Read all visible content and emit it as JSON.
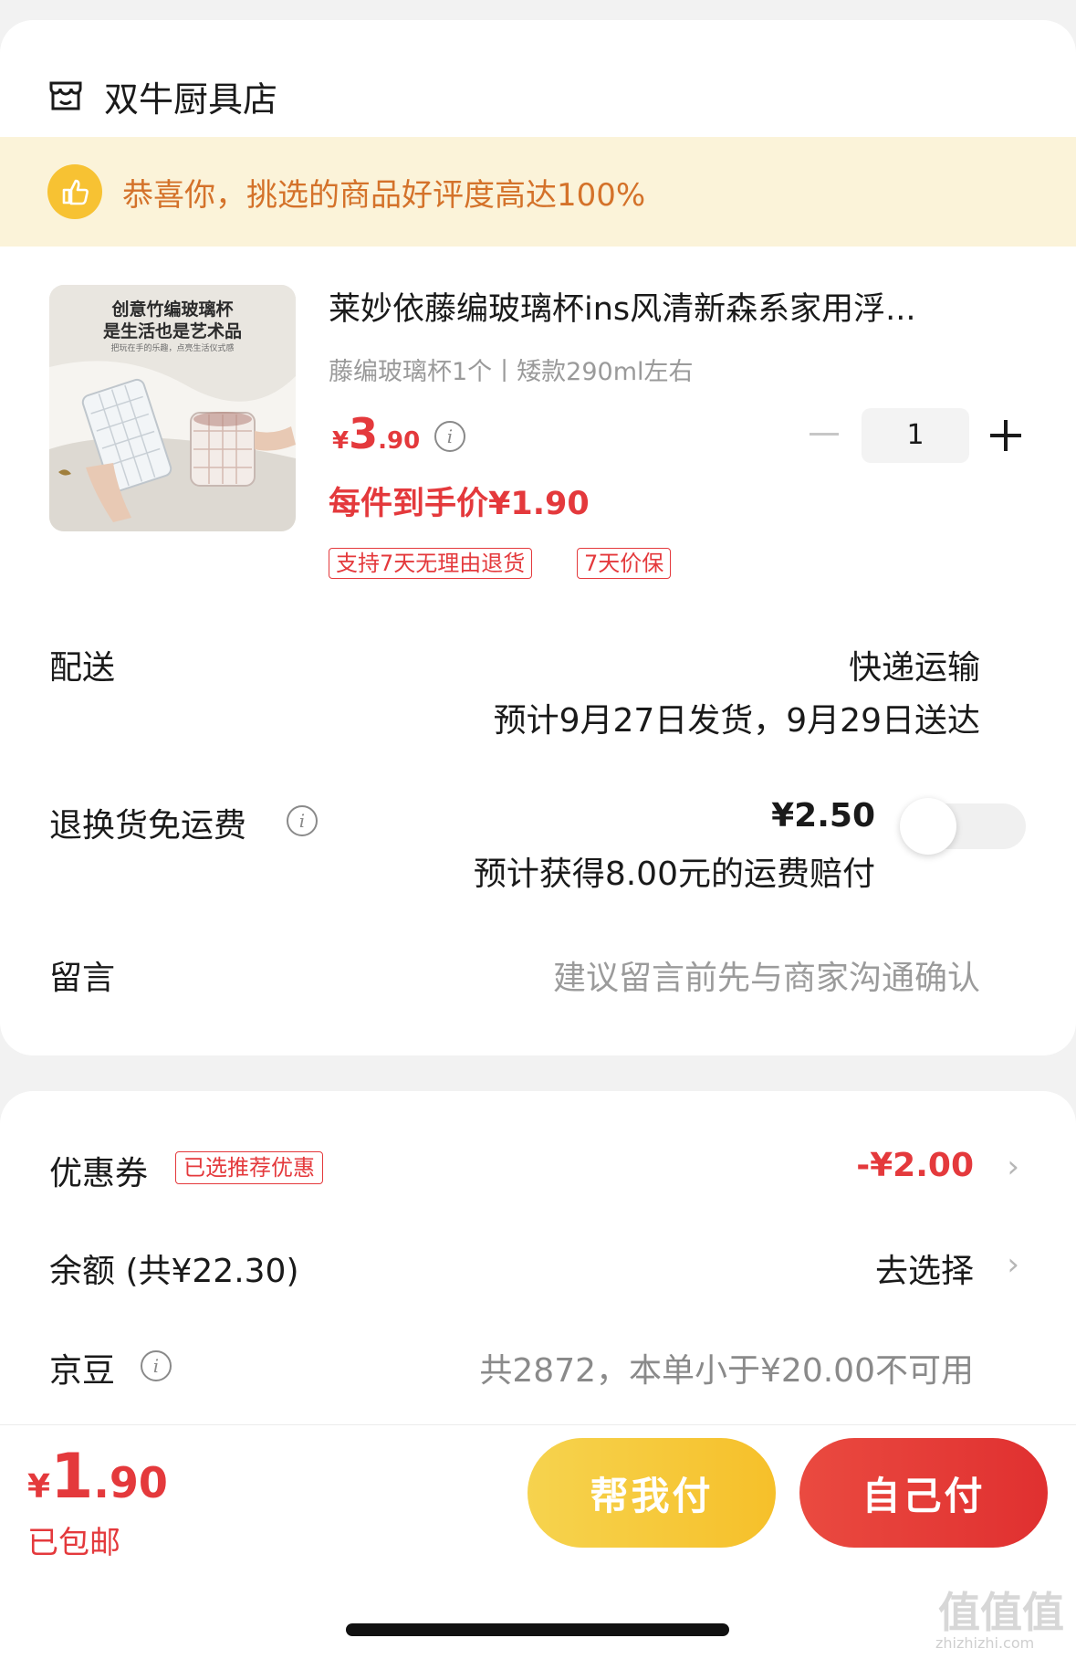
{
  "store": {
    "name": "双牛厨具店",
    "icon": "store-icon"
  },
  "banner": {
    "text": "恭喜你，挑选的商品好评度高达100%",
    "icon": "thumbs-up-icon"
  },
  "product": {
    "image_text": [
      "创意竹编玻璃杯",
      "是生活也是艺术品",
      "把玩在手的乐趣，点亮生活仪式感"
    ],
    "title": "莱妙依藤编玻璃杯ins风清新森系家用浮...",
    "spec": "藤编玻璃杯1个丨矮款290ml左右",
    "price": {
      "symbol": "¥",
      "integer": "3",
      "decimal": ".90"
    },
    "each_price": "每件到手价¥1.90",
    "tags": [
      "支持7天无理由退货",
      "7天价保"
    ],
    "quantity": "1"
  },
  "delivery": {
    "label": "配送",
    "method": "快递运输",
    "estimate": "预计9月27日发货，9月29日送达"
  },
  "return_shipping": {
    "label": "退换货免运费",
    "price": "¥2.50",
    "desc": "预计获得8.00元的运费赔付",
    "enabled": false
  },
  "message": {
    "label": "留言",
    "placeholder": "建议留言前先与商家沟通确认"
  },
  "coupon": {
    "label": "优惠券",
    "tag": "已选推荐优惠",
    "value": "-¥2.00"
  },
  "balance": {
    "label": "余额 (共¥22.30)",
    "action": "去选择"
  },
  "jingdou": {
    "label": "京豆",
    "value": "共2872，本单小于¥20.00不可用"
  },
  "footer": {
    "total": {
      "symbol": "¥",
      "integer": "1",
      "decimal": ".90"
    },
    "shipping": "已包邮",
    "help_pay": "帮我付",
    "self_pay": "自己付"
  },
  "watermark": {
    "glyphs": "值值值",
    "domain": "zhizhizhi.com"
  },
  "colors": {
    "accent_red": "#e4393c",
    "banner_bg": "#fbf3d9",
    "banner_text": "#d4722a",
    "help_pay": "#f6c933",
    "self_pay": "#e43b35"
  }
}
